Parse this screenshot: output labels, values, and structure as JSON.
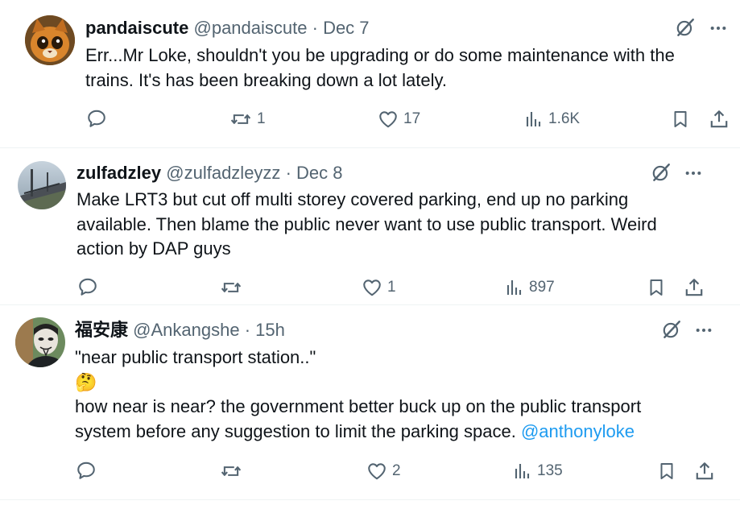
{
  "tweets": [
    {
      "display_name": "pandaiscute",
      "handle": "@pandaiscute",
      "separator": "·",
      "time": "Dec 7",
      "text_lines": [
        "Err...Mr Loke, shouldn't you be upgrading or do some maintenance with the",
        "trains. It's has been breaking down a lot lately."
      ],
      "reply_count": "",
      "retweet_count": "1",
      "like_count": "17",
      "view_count": "1.6K"
    },
    {
      "display_name": "zulfadzley",
      "handle": "@zulfadzleyzz",
      "separator": "·",
      "time": "Dec 8",
      "text_lines": [
        "Make LRT3 but cut off multi storey covered parking, end up no parking",
        "available. Then blame the public never want to use public transport. Weird",
        "action by DAP guys"
      ],
      "reply_count": "",
      "retweet_count": "",
      "like_count": "1",
      "view_count": "897"
    },
    {
      "display_name": "福安康",
      "handle": "@Ankangshe",
      "separator": "·",
      "time": "15h",
      "text_lines": [
        "\"near public transport station..\"",
        "🤔",
        "how near is near? the government better buck up on the public transport",
        "system before any suggestion to limit the parking space."
      ],
      "mention": "@anthonyloke",
      "reply_count": "",
      "retweet_count": "",
      "like_count": "2",
      "view_count": "135"
    }
  ],
  "colors": {
    "text": "#0f1419",
    "secondary": "#536471",
    "mention": "#1d9bf0",
    "separator": "#eff3f4"
  },
  "icons": [
    "grok-icon",
    "more-icon",
    "reply-icon",
    "retweet-icon",
    "like-icon",
    "views-icon",
    "bookmark-icon",
    "share-icon"
  ]
}
